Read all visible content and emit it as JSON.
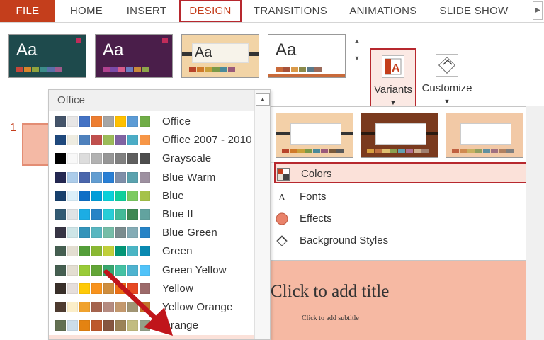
{
  "tabs": [
    "FILE",
    "HOME",
    "INSERT",
    "DESIGN",
    "TRANSITIONS",
    "ANIMATIONS",
    "SLIDE SHOW"
  ],
  "ribbon": {
    "variants_label": "Variants",
    "customize_label": "Customize",
    "theme_sample_text": "Aa"
  },
  "colors_panel": {
    "header": "Office",
    "schemes": [
      {
        "name": "Office",
        "colors": [
          "#44546a",
          "#e7e6e6",
          "#4472c4",
          "#ed7d31",
          "#a5a5a5",
          "#ffc000",
          "#5b9bd5",
          "#70ad47"
        ]
      },
      {
        "name": "Office 2007 - 2010",
        "colors": [
          "#1f497d",
          "#eeece1",
          "#4f81bd",
          "#c0504d",
          "#9bbb59",
          "#8064a2",
          "#4bacc6",
          "#f79646"
        ]
      },
      {
        "name": "Grayscale",
        "colors": [
          "#000000",
          "#f8f8f8",
          "#dddddd",
          "#b2b2b2",
          "#969696",
          "#808080",
          "#5f5f5f",
          "#4d4d4d"
        ]
      },
      {
        "name": "Blue Warm",
        "colors": [
          "#242852",
          "#acccea",
          "#4a66ac",
          "#629dd1",
          "#297fd5",
          "#7f8fa9",
          "#5aa2ae",
          "#9d90a0"
        ]
      },
      {
        "name": "Blue",
        "colors": [
          "#17406d",
          "#dbeff9",
          "#0f6fc6",
          "#009dd9",
          "#0bd0d9",
          "#10cf9b",
          "#7cca62",
          "#a5c249"
        ]
      },
      {
        "name": "Blue II",
        "colors": [
          "#335b74",
          "#dfe3e5",
          "#1cade4",
          "#2683c6",
          "#27ced7",
          "#42ba97",
          "#3e8853",
          "#62a39f"
        ]
      },
      {
        "name": "Blue Green",
        "colors": [
          "#373545",
          "#cee5e7",
          "#3494ba",
          "#58b6c0",
          "#75bda7",
          "#7a8c8e",
          "#84acb6",
          "#2683c6"
        ]
      },
      {
        "name": "Green",
        "colors": [
          "#455f51",
          "#e3ded1",
          "#549e39",
          "#8ab833",
          "#c0cf3a",
          "#029676",
          "#4ab5c4",
          "#0989b1"
        ]
      },
      {
        "name": "Green Yellow",
        "colors": [
          "#455f51",
          "#e3ded1",
          "#99cb38",
          "#63a537",
          "#37a76f",
          "#44c1a3",
          "#4eb3cf",
          "#51c3f9"
        ]
      },
      {
        "name": "Yellow",
        "colors": [
          "#39302a",
          "#e5dedb",
          "#ffca08",
          "#f8931d",
          "#ce8d3e",
          "#ec7016",
          "#e64823",
          "#9c6a6a"
        ]
      },
      {
        "name": "Yellow Orange",
        "colors": [
          "#4e3b30",
          "#fbeec9",
          "#f0a22e",
          "#a5644e",
          "#b58b80",
          "#c3986d",
          "#a19574",
          "#c17529"
        ]
      },
      {
        "name": "Orange",
        "colors": [
          "#637052",
          "#ccddea",
          "#e48312",
          "#bd582c",
          "#865640",
          "#9b8357",
          "#c2bc80",
          "#94a088"
        ]
      },
      {
        "name": "Orange Red",
        "colors": [
          "#505046",
          "#eeece1",
          "#e84c22",
          "#ffbd47",
          "#b64926",
          "#ff8427",
          "#cc9900",
          "#b22600"
        ]
      }
    ]
  },
  "variants_panel": {
    "menu": [
      {
        "label": "Colors"
      },
      {
        "label": "Fonts"
      },
      {
        "label": "Effects"
      },
      {
        "label": "Background Styles"
      }
    ]
  },
  "slides": {
    "number": "1",
    "title_placeholder": "Click to add title",
    "subtitle_placeholder": "Click to add subtitle"
  },
  "colors": {
    "accent": "#c43e1c",
    "highlight_border": "#b7282e",
    "hover_fill": "#fbe1d9",
    "slide_background": "#f6b9a3",
    "annotation_arrow": "#c0151b"
  },
  "icons": {
    "variants": "variants-icon",
    "customize": "format-background-icon",
    "colors": "colors-icon",
    "fonts": "fonts-icon",
    "effects": "effects-icon",
    "background_styles": "background-styles-icon"
  }
}
